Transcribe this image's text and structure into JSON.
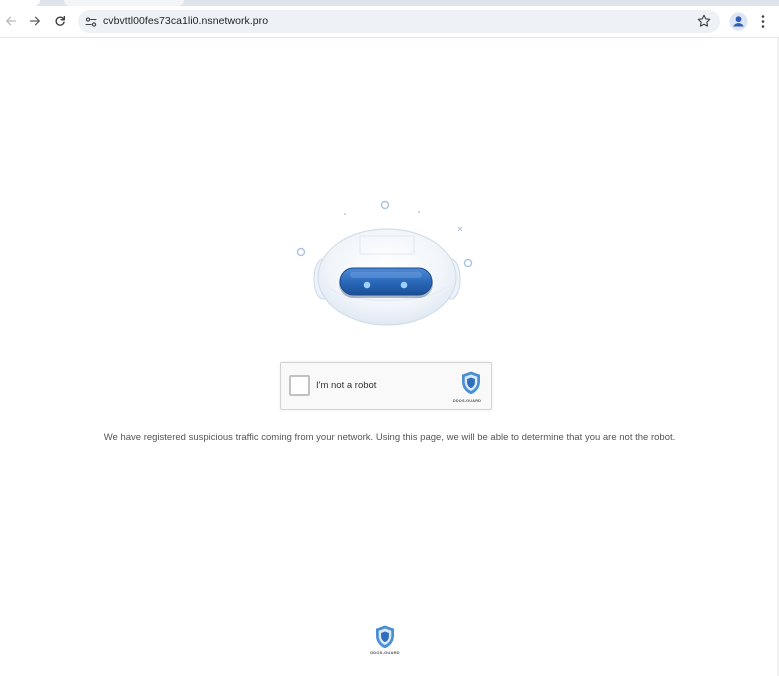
{
  "browser": {
    "url": "cvbvttl00fes73ca1li0.nsnetwork.pro",
    "icons": {
      "back": "arrow-left-icon",
      "forward": "arrow-right-icon",
      "reload": "reload-icon",
      "site_info": "tune-icon",
      "bookmark": "star-icon",
      "profile": "account-icon",
      "menu": "kebab-icon"
    }
  },
  "captcha": {
    "label": "I'm not a robot",
    "brand": "DDOS-GUARD",
    "checked": false
  },
  "notice": "We have registered suspicious traffic coming from your network. Using this page, we will be able to determine that you are not the robot.",
  "footer": {
    "brand": "DDOS-GUARD"
  },
  "colors": {
    "accent_blue": "#2f6fbd",
    "shield_blue": "#4a8fd4",
    "text_gray": "#555555"
  }
}
